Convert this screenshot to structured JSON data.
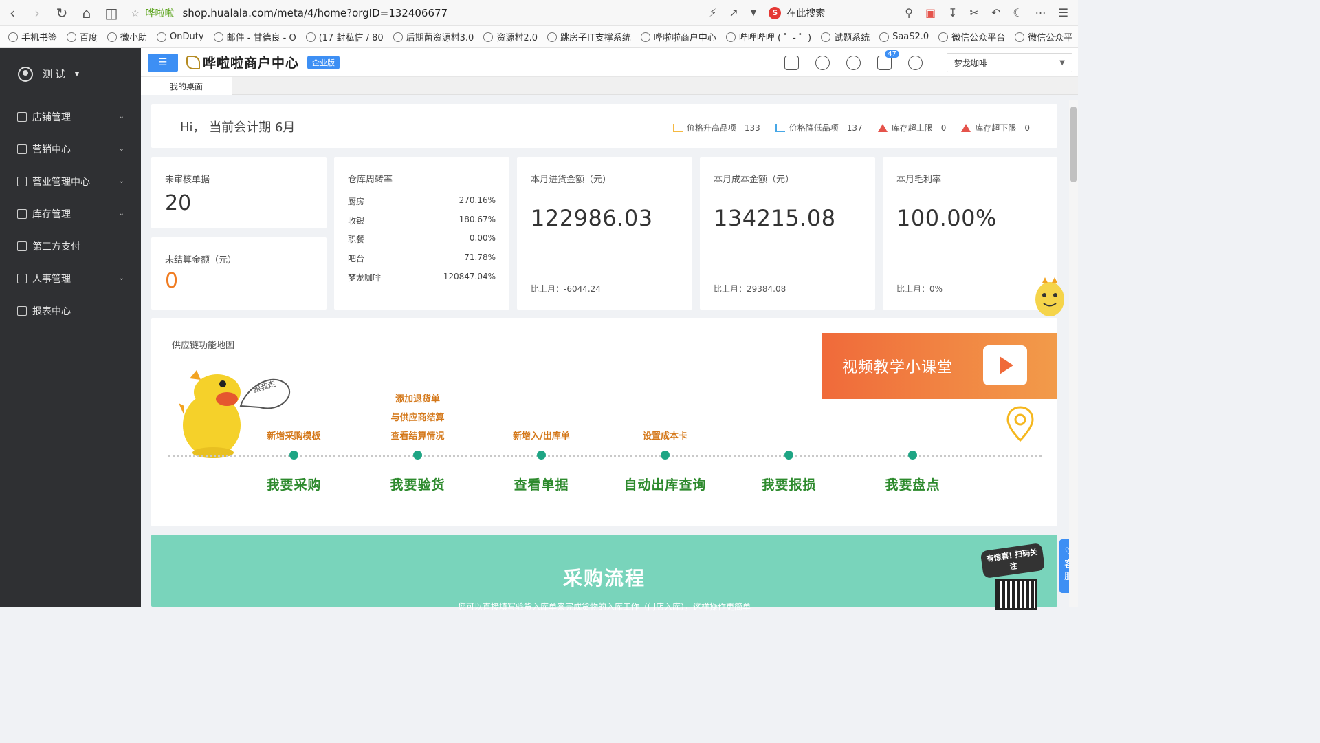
{
  "browser": {
    "site_name": "哗啦啦",
    "url": "shop.hualala.com/meta/4/home?orgID=132406677",
    "search_placeholder": "在此搜索"
  },
  "bookmarks": [
    {
      "label": "手机书签"
    },
    {
      "label": "百度"
    },
    {
      "label": "微小助"
    },
    {
      "label": "OnDuty"
    },
    {
      "label": "邮件 - 甘德良 - O"
    },
    {
      "label": "(17 封私信 / 80"
    },
    {
      "label": "后期菌资源村3.0"
    },
    {
      "label": "资源村2.0"
    },
    {
      "label": "跳房子IT支撑系统"
    },
    {
      "label": "哗啦啦商户中心"
    },
    {
      "label": "哔哩哔哩 ( ゜- ゜)"
    },
    {
      "label": "试题系统"
    },
    {
      "label": "SaaS2.0"
    },
    {
      "label": "微信公众平台"
    },
    {
      "label": "微信公众平"
    }
  ],
  "sidebar": {
    "user_name": "测 试",
    "items": [
      {
        "label": "店铺管理",
        "has_arrow": true
      },
      {
        "label": "营销中心",
        "has_arrow": true
      },
      {
        "label": "营业管理中心",
        "has_arrow": true
      },
      {
        "label": "库存管理",
        "has_arrow": true
      },
      {
        "label": "第三方支付",
        "has_arrow": false
      },
      {
        "label": "人事管理",
        "has_arrow": true
      },
      {
        "label": "报表中心",
        "has_arrow": false
      }
    ]
  },
  "header": {
    "title": "哗啦啦商户中心",
    "edition_badge": "企业版",
    "notification_count": "47",
    "store_select_value": "梦龙咖啡"
  },
  "tabs": [
    {
      "label": "我的桌面"
    }
  ],
  "greeting": {
    "text": "Hi，  当前会计期 6月",
    "stats": [
      {
        "label": "价格升高品项",
        "value": "133",
        "icon": "trend-up-icon"
      },
      {
        "label": "价格降低品项",
        "value": "137",
        "icon": "trend-down-icon"
      },
      {
        "label": "库存超上限",
        "value": "0",
        "icon": "warning-icon"
      },
      {
        "label": "库存超下限",
        "value": "0",
        "icon": "warning-icon"
      }
    ]
  },
  "cards": {
    "unreviewed": {
      "label": "未审核单据",
      "value": "20"
    },
    "unsettled": {
      "label": "未结算金额（元）",
      "value": "0"
    },
    "warehouse": {
      "label": "仓库周转率",
      "rows": [
        {
          "name": "厨房",
          "value": "270.16%"
        },
        {
          "name": "收银",
          "value": "180.67%"
        },
        {
          "name": "职餐",
          "value": "0.00%"
        },
        {
          "name": "吧台",
          "value": "71.78%"
        },
        {
          "name": "梦龙咖啡",
          "value": "-120847.04%"
        }
      ]
    },
    "purchase": {
      "label": "本月进货金额（元）",
      "value": "122986.03",
      "compare": "比上月：-6044.24"
    },
    "cost": {
      "label": "本月成本金额（元）",
      "value": "134215.08",
      "compare": "比上月：29384.08"
    },
    "margin": {
      "label": "本月毛利率",
      "value": "100.00%",
      "compare": "比上月：0%"
    }
  },
  "supply_map": {
    "title": "供应链功能地图",
    "video_banner": "视频教学小课堂",
    "speech": "跟我走",
    "steps": [
      {
        "top": [
          "新增采购模板"
        ],
        "label": "我要采购"
      },
      {
        "top": [
          "添加退货单",
          "与供应商结算",
          "查看结算情况"
        ],
        "label": "我要验货"
      },
      {
        "top": [
          "新增入/出库单"
        ],
        "label": "查看单据"
      },
      {
        "top": [
          "设置成本卡"
        ],
        "label": "自动出库查询"
      },
      {
        "top": [],
        "label": "我要报损"
      },
      {
        "top": [],
        "label": "我要盘点"
      }
    ]
  },
  "process": {
    "title": "采购流程",
    "subtitle": "您可以直接填写验货入库单来完成货物的入库工作（门店入库），这样操作更简单",
    "promo": "有惊喜! 扫码关注"
  },
  "service_button": "客服",
  "colors": {
    "accent": "#3d8ff4",
    "sidebar_bg": "#2f3033",
    "banner_orange": "#f06a3a",
    "process_teal": "#79d4bb",
    "node_green": "#1ea584"
  }
}
